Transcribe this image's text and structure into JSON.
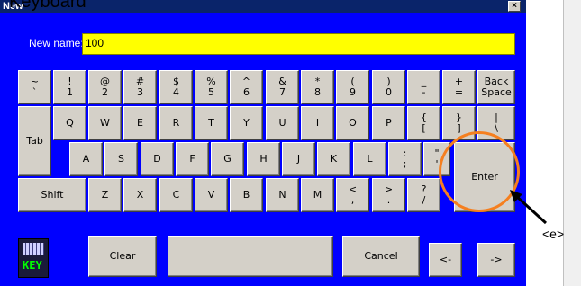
{
  "caption": "Keyboard",
  "window": {
    "title": "New",
    "close": "×"
  },
  "name_label": "New name:",
  "name_value": "100",
  "keys": {
    "row1": [
      "~\n`",
      "!\n1",
      "@\n2",
      "#\n3",
      "$\n4",
      "%\n5",
      "^\n6",
      "&\n7",
      "*\n8",
      "(\n9",
      ")\n0",
      "_\n-",
      "+\n=",
      "Back\nSpace"
    ],
    "row2": [
      "Tab",
      "Q",
      "W",
      "E",
      "R",
      "T",
      "Y",
      "U",
      "I",
      "O",
      "P",
      "{\n[",
      "}\n]",
      "|\n\\"
    ],
    "row3": [
      "A",
      "S",
      "D",
      "F",
      "G",
      "H",
      "J",
      "K",
      "L",
      ":\n;",
      "\"\n'",
      "Enter"
    ],
    "row4": [
      "Shift",
      "Z",
      "X",
      "C",
      "V",
      "B",
      "N",
      "M",
      "<\n,",
      ">\n.",
      "?\n/"
    ],
    "row5": [
      "Clear",
      "",
      "Cancel",
      "<-",
      "->"
    ]
  },
  "logo_label": "KEY",
  "annotation": "<e>",
  "colors": {
    "background": "#0000ff",
    "input": "#ffff00",
    "key": "#d4d0c8",
    "highlight": "#f57f1f"
  }
}
